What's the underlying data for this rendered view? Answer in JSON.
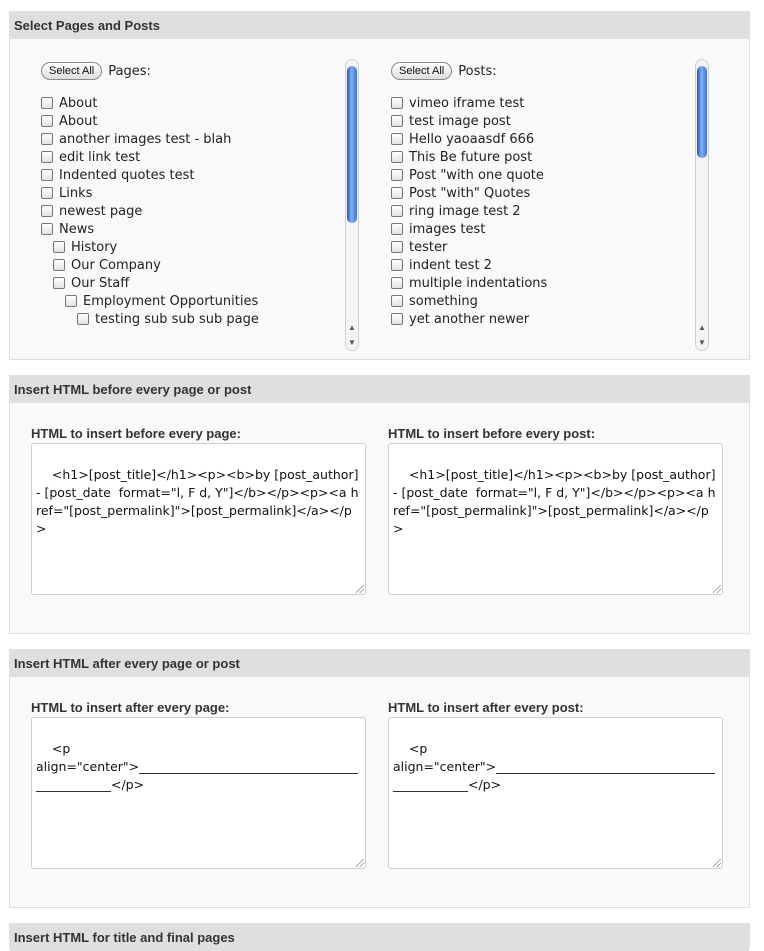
{
  "select_section": {
    "title": "Select Pages and Posts",
    "pages": {
      "select_all_label": "Select All",
      "label": "Pages:",
      "items": [
        {
          "label": "About",
          "level": 0
        },
        {
          "label": "About",
          "level": 0
        },
        {
          "label": "another images test - blah",
          "level": 0
        },
        {
          "label": "edit link test",
          "level": 0
        },
        {
          "label": "Indented quotes test",
          "level": 0
        },
        {
          "label": "Links",
          "level": 0
        },
        {
          "label": "newest page",
          "level": 0
        },
        {
          "label": "News",
          "level": 0
        },
        {
          "label": "History",
          "level": 1
        },
        {
          "label": "Our Company",
          "level": 1
        },
        {
          "label": "Our Staff",
          "level": 1
        },
        {
          "label": "Employment Opportunities",
          "level": 2
        },
        {
          "label": "testing sub sub sub page",
          "level": 3
        }
      ]
    },
    "posts": {
      "select_all_label": "Select All",
      "label": "Posts:",
      "items": [
        {
          "label": "vimeo iframe test",
          "level": 0
        },
        {
          "label": "test image post",
          "level": 0
        },
        {
          "label": "Hello yaoaasdf 666",
          "level": 0
        },
        {
          "label": "This Be future post",
          "level": 0
        },
        {
          "label": "Post \"with one quote",
          "level": 0
        },
        {
          "label": "Post \"with\" Quotes",
          "level": 0
        },
        {
          "label": "ring image test 2",
          "level": 0
        },
        {
          "label": "images test",
          "level": 0
        },
        {
          "label": "tester",
          "level": 0
        },
        {
          "label": "indent test 2",
          "level": 0
        },
        {
          "label": "multiple indentations",
          "level": 0
        },
        {
          "label": "something",
          "level": 0
        },
        {
          "label": "yet another newer",
          "level": 0
        }
      ]
    }
  },
  "before_section": {
    "title": "Insert HTML before every page or post",
    "page_label": "HTML to insert before every page:",
    "page_value": "<h1>[post_title]</h1><p><b>by [post_author] - [post_date  format=\"l, F d, Y\"]</b></p><p><a href=\"[post_permalink]\">[post_permalink]</a></p>",
    "post_label": "HTML to insert before every post:",
    "post_value": "<h1>[post_title]</h1><p><b>by [post_author] - [post_date  format=\"l, F d, Y\"]</b></p><p><a href=\"[post_permalink]\">[post_permalink]</a></p>"
  },
  "after_section": {
    "title": "Insert HTML after every page or post",
    "page_label": "HTML to insert after every page:",
    "page_value": "<p\nalign=\"center\">_______________________________________________</p>",
    "post_label": "HTML to insert after every post:",
    "post_value": "<p\nalign=\"center\">_______________________________________________</p>"
  },
  "title_section": {
    "title": "Insert HTML for title and final pages"
  },
  "icons": {
    "scroll_up": "▲",
    "scroll_down": "▼"
  }
}
